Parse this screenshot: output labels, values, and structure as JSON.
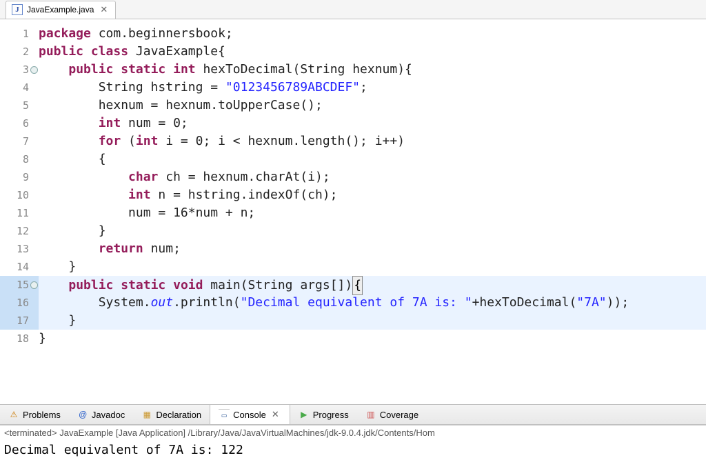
{
  "editor_tab": {
    "filename": "JavaExample.java",
    "icon_letter": "J",
    "close_glyph": "✕"
  },
  "code": {
    "lines": [
      {
        "n": "1",
        "fold": false,
        "hl": false,
        "tokens": [
          [
            "kw",
            "package"
          ],
          [
            "pln",
            " com.beginnersbook;"
          ]
        ]
      },
      {
        "n": "2",
        "fold": false,
        "hl": false,
        "tokens": [
          [
            "kw",
            "public"
          ],
          [
            "pln",
            " "
          ],
          [
            "kw",
            "class"
          ],
          [
            "pln",
            " JavaExample{"
          ]
        ]
      },
      {
        "n": "3",
        "fold": true,
        "hl": false,
        "tokens": [
          [
            "pln",
            "    "
          ],
          [
            "kw",
            "public"
          ],
          [
            "pln",
            " "
          ],
          [
            "kw",
            "static"
          ],
          [
            "pln",
            " "
          ],
          [
            "kw",
            "int"
          ],
          [
            "pln",
            " hexToDecimal(String hexnum){"
          ]
        ]
      },
      {
        "n": "4",
        "fold": false,
        "hl": false,
        "tokens": [
          [
            "pln",
            "        String hstring = "
          ],
          [
            "str",
            "\"0123456789ABCDEF\""
          ],
          [
            "pln",
            ";"
          ]
        ]
      },
      {
        "n": "5",
        "fold": false,
        "hl": false,
        "tokens": [
          [
            "pln",
            "        hexnum = hexnum.toUpperCase();"
          ]
        ]
      },
      {
        "n": "6",
        "fold": false,
        "hl": false,
        "tokens": [
          [
            "pln",
            "        "
          ],
          [
            "kw",
            "int"
          ],
          [
            "pln",
            " num = 0;"
          ]
        ]
      },
      {
        "n": "7",
        "fold": false,
        "hl": false,
        "tokens": [
          [
            "pln",
            "        "
          ],
          [
            "kw",
            "for"
          ],
          [
            "pln",
            " ("
          ],
          [
            "kw",
            "int"
          ],
          [
            "pln",
            " i = 0; i < hexnum.length(); i++)"
          ]
        ]
      },
      {
        "n": "8",
        "fold": false,
        "hl": false,
        "tokens": [
          [
            "pln",
            "        {"
          ]
        ]
      },
      {
        "n": "9",
        "fold": false,
        "hl": false,
        "tokens": [
          [
            "pln",
            "            "
          ],
          [
            "kw",
            "char"
          ],
          [
            "pln",
            " ch = hexnum.charAt(i);"
          ]
        ]
      },
      {
        "n": "10",
        "fold": false,
        "hl": false,
        "tokens": [
          [
            "pln",
            "            "
          ],
          [
            "kw",
            "int"
          ],
          [
            "pln",
            " n = hstring.indexOf(ch);"
          ]
        ]
      },
      {
        "n": "11",
        "fold": false,
        "hl": false,
        "tokens": [
          [
            "pln",
            "            num = 16*num + n;"
          ]
        ]
      },
      {
        "n": "12",
        "fold": false,
        "hl": false,
        "tokens": [
          [
            "pln",
            "        }"
          ]
        ]
      },
      {
        "n": "13",
        "fold": false,
        "hl": false,
        "tokens": [
          [
            "pln",
            "        "
          ],
          [
            "kw",
            "return"
          ],
          [
            "pln",
            " num;"
          ]
        ]
      },
      {
        "n": "14",
        "fold": false,
        "hl": false,
        "tokens": [
          [
            "pln",
            "    }"
          ]
        ]
      },
      {
        "n": "15",
        "fold": true,
        "hl": true,
        "tokens": [
          [
            "pln",
            "    "
          ],
          [
            "kw",
            "public"
          ],
          [
            "pln",
            " "
          ],
          [
            "kw",
            "static"
          ],
          [
            "pln",
            " "
          ],
          [
            "kw",
            "void"
          ],
          [
            "pln",
            " main(String args[])"
          ],
          [
            "caret",
            "{"
          ]
        ]
      },
      {
        "n": "16",
        "fold": false,
        "hl": true,
        "tokens": [
          [
            "pln",
            "        System."
          ],
          [
            "st-it",
            "out"
          ],
          [
            "pln",
            ".println("
          ],
          [
            "str",
            "\"Decimal equivalent of 7A is: \""
          ],
          [
            "pln",
            "+hexToDecimal("
          ],
          [
            "str",
            "\"7A\""
          ],
          [
            "pln",
            "));"
          ]
        ]
      },
      {
        "n": "17",
        "fold": false,
        "hl": true,
        "tokens": [
          [
            "pln",
            "    }"
          ]
        ]
      },
      {
        "n": "18",
        "fold": false,
        "hl": false,
        "tokens": [
          [
            "pln",
            "}"
          ]
        ]
      }
    ]
  },
  "views": {
    "items": [
      {
        "label": "Problems",
        "icon": "problems",
        "glyph": "⚠",
        "active": false
      },
      {
        "label": "Javadoc",
        "icon": "javadoc",
        "glyph": "@",
        "active": false
      },
      {
        "label": "Declaration",
        "icon": "declaration",
        "glyph": "▦",
        "active": false
      },
      {
        "label": "Console",
        "icon": "console",
        "glyph": "▭",
        "active": true,
        "close_glyph": "✕"
      },
      {
        "label": "Progress",
        "icon": "progress",
        "glyph": "▶",
        "active": false
      },
      {
        "label": "Coverage",
        "icon": "coverage",
        "glyph": "▥",
        "active": false
      }
    ]
  },
  "console": {
    "header": "<terminated> JavaExample [Java Application] /Library/Java/JavaVirtualMachines/jdk-9.0.4.jdk/Contents/Hom",
    "output": "Decimal equivalent of 7A is: 122"
  }
}
